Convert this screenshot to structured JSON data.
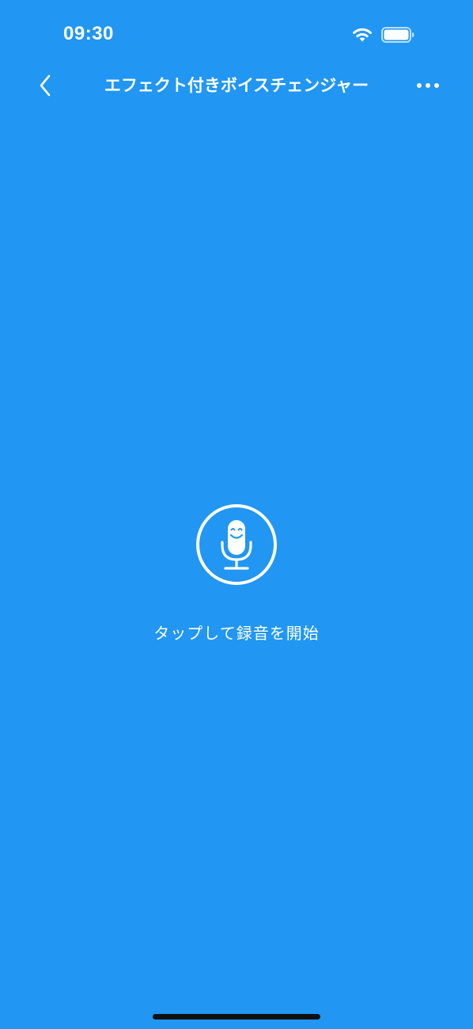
{
  "status_bar": {
    "time": "09:30",
    "wifi_icon": "wifi-icon",
    "battery_icon": "battery-icon"
  },
  "nav": {
    "back_icon": "chevron-left-icon",
    "title": "エフェクト付きボイスチェンジャー",
    "more_icon": "more-horizontal-icon"
  },
  "main": {
    "record_icon": "smiling-microphone-icon",
    "record_label": "タップして録音を開始"
  },
  "colors": {
    "background": "#2196F3",
    "foreground": "#FFFFFF",
    "home_indicator": "#111111"
  }
}
